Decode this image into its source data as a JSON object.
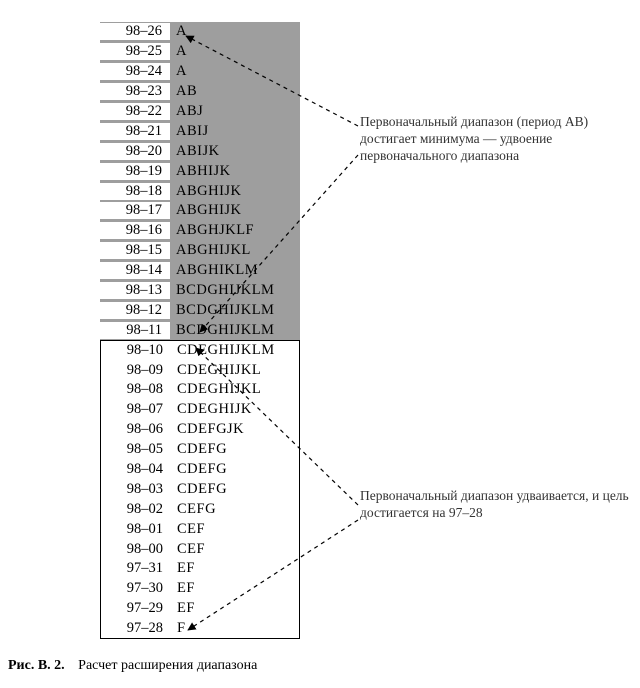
{
  "rows": [
    {
      "key": "98–26",
      "val": "A",
      "group": "shaded"
    },
    {
      "key": "98–25",
      "val": "A",
      "group": "shaded"
    },
    {
      "key": "98–24",
      "val": "A",
      "group": "shaded"
    },
    {
      "key": "98–23",
      "val": "AB",
      "group": "shaded"
    },
    {
      "key": "98–22",
      "val": "ABJ",
      "group": "shaded"
    },
    {
      "key": "98–21",
      "val": "ABIJ",
      "group": "shaded"
    },
    {
      "key": "98–20",
      "val": "ABIJK",
      "group": "shaded"
    },
    {
      "key": "98–19",
      "val": "ABHIJK",
      "group": "shaded"
    },
    {
      "key": "98–18",
      "val": "ABGHIJK",
      "group": "shaded"
    },
    {
      "key": "98–17",
      "val": "ABGHIJK",
      "group": "shaded"
    },
    {
      "key": "98–16",
      "val": "ABGHJKLF",
      "group": "shaded"
    },
    {
      "key": "98–15",
      "val": "ABGHIJKL",
      "group": "shaded"
    },
    {
      "key": "98–14",
      "val": "ABGHIKLM",
      "group": "shaded"
    },
    {
      "key": "98–13",
      "val": "BCDGHIJKLM",
      "group": "shaded"
    },
    {
      "key": "98–12",
      "val": "BCDGHIJKLM",
      "group": "shaded"
    },
    {
      "key": "98–11",
      "val": "BCDGHIJKLM",
      "group": "shaded"
    },
    {
      "key": "98–10",
      "val": "CDEGHIJKLM",
      "group": "boxed",
      "first": true
    },
    {
      "key": "98–09",
      "val": "CDEGHIJKL",
      "group": "boxed"
    },
    {
      "key": "98–08",
      "val": "CDEGHIJKL",
      "group": "boxed"
    },
    {
      "key": "98–07",
      "val": "CDEGHIJK",
      "group": "boxed"
    },
    {
      "key": "98–06",
      "val": "CDEFGJK",
      "group": "boxed"
    },
    {
      "key": "98–05",
      "val": "CDEFG",
      "group": "boxed"
    },
    {
      "key": "98–04",
      "val": "CDEFG",
      "group": "boxed"
    },
    {
      "key": "98–03",
      "val": "CDEFG",
      "group": "boxed"
    },
    {
      "key": "98–02",
      "val": "CEFG",
      "group": "boxed"
    },
    {
      "key": "98–01",
      "val": "CEF",
      "group": "boxed"
    },
    {
      "key": "98–00",
      "val": "CEF",
      "group": "boxed"
    },
    {
      "key": "97–31",
      "val": "EF",
      "group": "boxed"
    },
    {
      "key": "97–30",
      "val": "EF",
      "group": "boxed"
    },
    {
      "key": "97–29",
      "val": "EF",
      "group": "boxed"
    },
    {
      "key": "97–28",
      "val": "F",
      "group": "boxed",
      "last": true
    }
  ],
  "annotations": {
    "top": "Первоначальный диапазон (период AB) достигает минимума — удвоение первоначального диапазона",
    "bottom": "Первоначальный диапазон удваивается, и цель достигается на 97–28"
  },
  "caption": {
    "label": "Рис. В. 2.",
    "text": "Расчет расширения диапазона"
  }
}
